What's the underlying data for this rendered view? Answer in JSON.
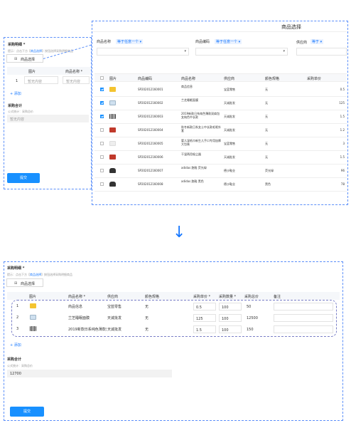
{
  "top_form": {
    "purchase_detail_label": "采购明细 *",
    "hint_prefix": "提示：点击下方【",
    "hint_link": "商品选择",
    "hint_suffix": "】按钮选择采购明细商品",
    "select_button": "商品选择",
    "table_headers": [
      "图片",
      "商品名称 *"
    ],
    "row_index": "1",
    "placeholder": "暂无内容",
    "add_link": "+ 添加",
    "total_title": "采购合计",
    "formula": "公式统计：采购总价",
    "total_placeholder": "暂无内容",
    "submit": "提交"
  },
  "modal": {
    "title": "商品选择",
    "filters": [
      {
        "label": "商品名称",
        "op": "等于任意一个"
      },
      {
        "label": "商品编码",
        "op": "等于任意一个"
      },
      {
        "label": "供应商",
        "op": "等于"
      }
    ],
    "headers": [
      "图片",
      "商品编码",
      "商品名称",
      "供应商",
      "颜色规格",
      "采购单价"
    ],
    "rows": [
      {
        "checked": true,
        "thumb": "gold",
        "code": "SP202012160001",
        "name": "商品信息",
        "supplier": "宝蓝零售",
        "color": "无",
        "price": "0.5"
      },
      {
        "checked": true,
        "thumb": "box",
        "code": "SP202012160002",
        "name": "兰芝睡眠面膜",
        "supplier": "天诚批发",
        "color": "无",
        "price": "125"
      },
      {
        "checked": true,
        "thumb": "bar",
        "code": "SP202012160003",
        "name": "2019新款日系纯色薄款双肩包女纯色中长款",
        "supplier": "天诚批发",
        "color": "无",
        "price": "1.5"
      },
      {
        "checked": false,
        "thumb": "red",
        "code": "SP202012160004",
        "name": "秋冬新款日系女士中长款毛呢外套",
        "supplier": "天诚批发",
        "color": "无",
        "price": "1.2"
      },
      {
        "checked": false,
        "thumb": "light",
        "code": "SP202012160005",
        "name": "婴儿湿纸巾新生儿手口专用加厚大包装",
        "supplier": "宝蓝零售",
        "color": "无",
        "price": "3"
      },
      {
        "checked": false,
        "thumb": "red",
        "code": "SP202012160006",
        "name": "干湿两用吸尘器",
        "supplier": "天诚批发",
        "color": "无",
        "price": "1.5"
      },
      {
        "checked": false,
        "thumb": "dark",
        "code": "SP202012160007",
        "name": "adidas 跑鞋 荧光绿",
        "supplier": "德沙鞋业",
        "color": "荧光绿",
        "price": "96"
      },
      {
        "checked": false,
        "thumb": "dark",
        "code": "SP202012160008",
        "name": "adidas 跑鞋 黑色",
        "supplier": "德沙鞋业",
        "color": "黑色",
        "price": "78"
      }
    ]
  },
  "arrow": "↓",
  "bottom_form": {
    "purchase_detail_label": "采购明细 *",
    "hint_prefix": "提示：点击下方【",
    "hint_link": "商品选择",
    "hint_suffix": "】按钮选择采购明细商品",
    "select_button": "商品选择",
    "headers": [
      "图片",
      "商品名称 *",
      "供应商",
      "颜色规格",
      "采购单价 *",
      "采购数量 *",
      "采购总价",
      "备注"
    ],
    "rows": [
      {
        "index": "1",
        "thumb": "gold",
        "name": "商品信息",
        "supplier": "宝蓝零售",
        "color": "无",
        "price": "0.5",
        "qty": "100",
        "total": "50"
      },
      {
        "index": "2",
        "thumb": "box",
        "name": "兰芝睡眠面膜",
        "supplier": "天诚批发",
        "color": "无",
        "price": "125",
        "qty": "100",
        "total": "12500"
      },
      {
        "index": "3",
        "thumb": "bar",
        "name": "2019新款日系纯色薄款双",
        "supplier": "天诚批发",
        "color": "无",
        "price": "1.5",
        "qty": "100",
        "total": "150"
      }
    ],
    "add_link": "+ 添加",
    "total_title": "采购合计",
    "formula": "公式统计：采购总价",
    "total_value": "12700",
    "submit": "提交"
  }
}
